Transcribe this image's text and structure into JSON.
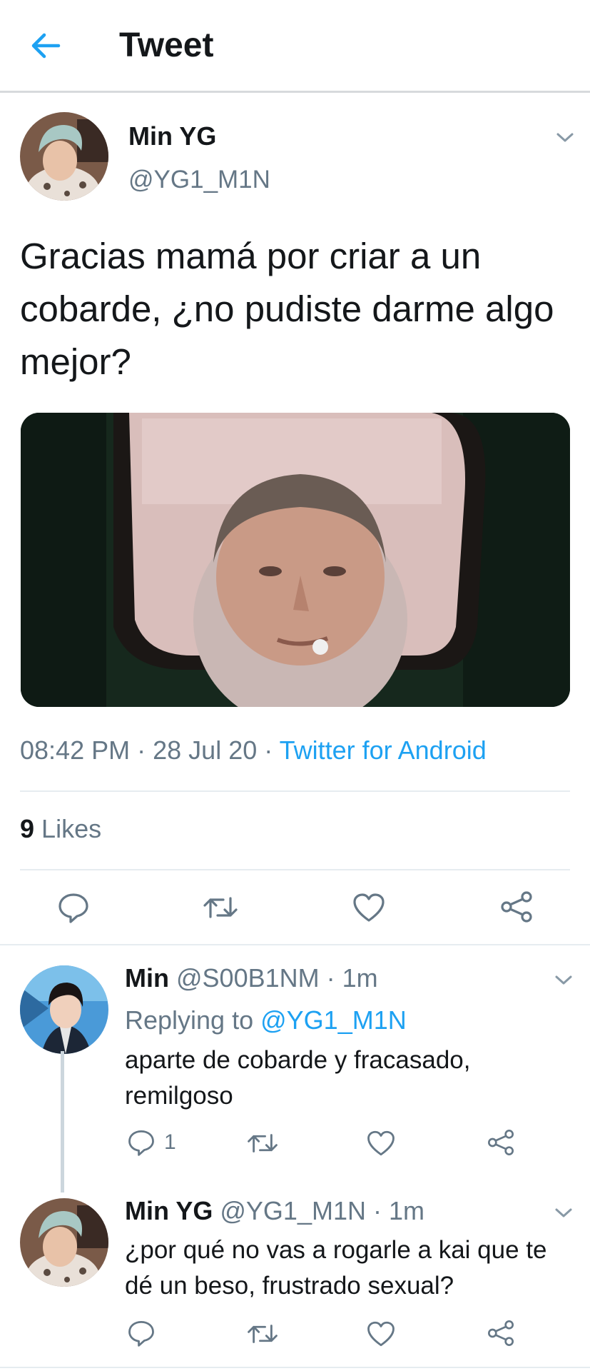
{
  "header": {
    "title": "Tweet"
  },
  "tweet": {
    "name": "Min YG",
    "handle": "@YG1_M1N",
    "text": "Gracias mamá por criar a un cobarde, ¿no pudiste darme algo mejor?",
    "time": "08:42 PM",
    "date": "28 Jul 20",
    "sep": "·",
    "source": "Twitter for Android",
    "likes_count": "9",
    "likes_label": "Likes"
  },
  "replies": [
    {
      "name": "Min",
      "handle": "@S00B1NM",
      "time": "1m",
      "replying_prefix": "Replying to",
      "replying_to": "@YG1_M1N",
      "text": "aparte de cobarde y fracasado, remilgoso",
      "reply_count": "1"
    },
    {
      "name": "Min YG",
      "handle": "@YG1_M1N",
      "time": "1m",
      "text": "¿por qué no vas a rogarle a kai que te dé un beso, frustrado sexual?"
    }
  ],
  "colors": {
    "accent": "#1da1f2",
    "icon": "#657786",
    "text": "#14171a",
    "divider": "#e6ecf0"
  }
}
